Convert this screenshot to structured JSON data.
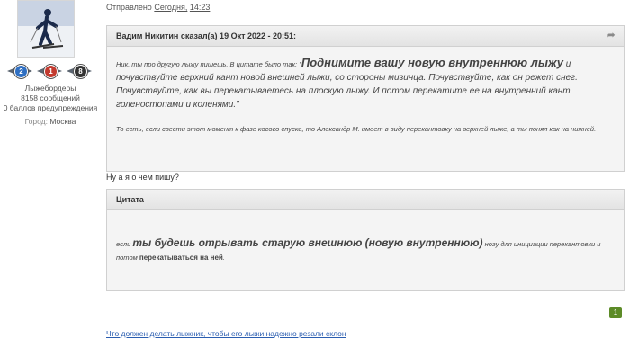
{
  "user": {
    "forum_name": "Лыжебордеры",
    "messages": "8158 сообщений",
    "warnings": "0 баллов предупреждения",
    "city_label": "Город:",
    "city_value": "Москва"
  },
  "badges": [
    {
      "value": "2",
      "color": "#2f6fc2"
    },
    {
      "value": "1",
      "color": "#c23a2f"
    },
    {
      "value": "8",
      "color": "#333333"
    }
  ],
  "post": {
    "posted_label": "Отправлено",
    "posted_day": "Сегодня,",
    "posted_time": "14:23",
    "reply_text": "Ну а я о чем пишу?"
  },
  "quote1": {
    "header": "Вадим Никитин сказал(а) 19 Окт 2022 - 20:51:",
    "intro": "Ник, ты про другую лыжу пишешь. В цитате было так: \"",
    "bold": "Поднимите вашу новую внутреннюю лыжу",
    "rest": " и почувствуйте верхний кант новой внешней лыжи, со стороны мизинца. Почувствуйте, как он режет снег. Почувствуйте, как вы перекатываетесь на плоскую лыжу. И потом перекатите ее на внутренний кант голеностопами и коленями.\"",
    "note": "То есть, если свести этот момент к фазе косого спуска, то Александр М. имеет в виду перекантовку на верхней лыже, а ты понял как на нижней."
  },
  "quote2": {
    "header": "Цитата",
    "pre": "если ",
    "bold": "ты будешь отрывать старую внешнюю (новую внутреннюю)",
    "post": " ногу для инициации перекантовки и потом ",
    "bold2": "перекатываться на ней",
    "end": "."
  },
  "pagination": {
    "page": "1"
  },
  "next_link": "Что должен делать лыжник, чтобы его лыжи надежно резали склон"
}
